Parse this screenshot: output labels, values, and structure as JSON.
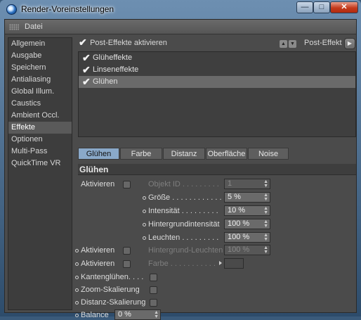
{
  "window": {
    "title": "Render-Voreinstellungen"
  },
  "menu": {
    "file": "Datei"
  },
  "sidebar": {
    "items": [
      {
        "label": "Allgemein"
      },
      {
        "label": "Ausgabe"
      },
      {
        "label": "Speichern"
      },
      {
        "label": "Antialiasing"
      },
      {
        "label": "Global Illum."
      },
      {
        "label": "Caustics"
      },
      {
        "label": "Ambient Occl."
      },
      {
        "label": "Effekte"
      },
      {
        "label": "Optionen"
      },
      {
        "label": "Multi-Pass"
      },
      {
        "label": "QuickTime VR"
      }
    ],
    "selected": "Effekte"
  },
  "post": {
    "label": "Post-Effekte aktivieren",
    "checked": true,
    "type_label": "Post-Effekt"
  },
  "effects_list": [
    {
      "label": "Glüheffekte",
      "checked": true
    },
    {
      "label": "Linseneffekte",
      "checked": true
    },
    {
      "label": "Glühen",
      "checked": true,
      "selected": true
    }
  ],
  "tabs": [
    {
      "label": "Glühen",
      "active": true
    },
    {
      "label": "Farbe"
    },
    {
      "label": "Distanz"
    },
    {
      "label": "Oberfläche"
    },
    {
      "label": "Noise"
    }
  ],
  "section": {
    "title": "Glühen"
  },
  "params": {
    "aktivieren1": "Aktivieren",
    "objekt_id": {
      "label": "Objekt ID . . . . . . . . .",
      "value": "1"
    },
    "groesse": {
      "label": "Größe . . . . . . . . . . . .",
      "value": "5 %"
    },
    "intensitaet": {
      "label": "Intensität  . . . . . . . . .",
      "value": "10 %"
    },
    "hintergrundintensitaet": {
      "label": "Hintergrundintensität",
      "value": "100 %"
    },
    "leuchten": {
      "label": "Leuchten . . . . . . . . .",
      "value": "100 %"
    },
    "aktivieren2": "Aktivieren",
    "hintergrund_leuchten": {
      "label": "Hintergrund-Leuchten",
      "value": "100 %"
    },
    "aktivieren3": "Aktivieren",
    "farbe": {
      "label": "Farbe . . . . . . . . . . ."
    },
    "kantengluehen": "Kantenglühen. . . .",
    "zoom_skalierung": "Zoom-Skalierung",
    "distanz_skalierung": "Distanz-Skalierung",
    "balance": {
      "label": "Balance",
      "value": "0 %"
    }
  }
}
